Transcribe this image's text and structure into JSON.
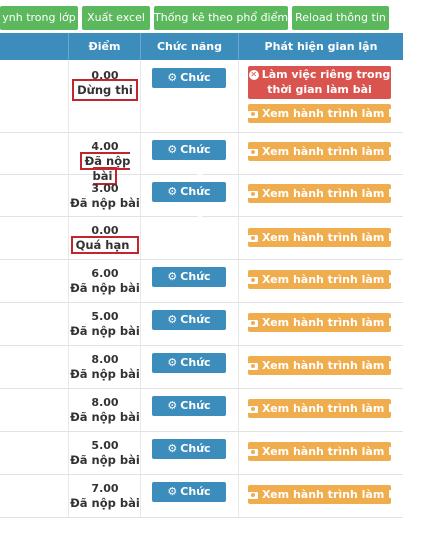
{
  "toolbar": {
    "buttons": [
      {
        "label": "ynh trong lớp"
      },
      {
        "label": "Xuất excel"
      },
      {
        "label": "Thống kê theo phổ điểm"
      },
      {
        "label": "Reload thông tin"
      }
    ]
  },
  "table": {
    "headers": {
      "score": "Điểm",
      "function": "Chức năng",
      "cheat": "Phát hiện gian lận"
    },
    "function_label": "Chức năng",
    "journey_label": "Xem hành trình làm bài",
    "private_label": "Làm việc riêng trong thời gian làm bài",
    "rows": [
      {
        "score": "0.00",
        "status": "Dừng thi"
      },
      {
        "score": "4.00",
        "status": "Đã nộp bài"
      },
      {
        "score": "3.00",
        "status": "Đã nộp bài"
      },
      {
        "score": "0.00",
        "status": "Quá hạn"
      },
      {
        "score": "6.00",
        "status": "Đã nộp bài"
      },
      {
        "score": "5.00",
        "status": "Đã nộp bài"
      },
      {
        "score": "8.00",
        "status": "Đã nộp bài"
      },
      {
        "score": "8.00",
        "status": "Đã nộp bài"
      },
      {
        "score": "5.00",
        "status": "Đã nộp bài"
      },
      {
        "score": "7.00",
        "status": "Đã nộp bài"
      }
    ]
  },
  "colors": {
    "green": "#5cb85c",
    "blue": "#3c8dbc",
    "orange": "#f0ad4e",
    "red": "#d9534f",
    "highlight": "#c0262d"
  }
}
